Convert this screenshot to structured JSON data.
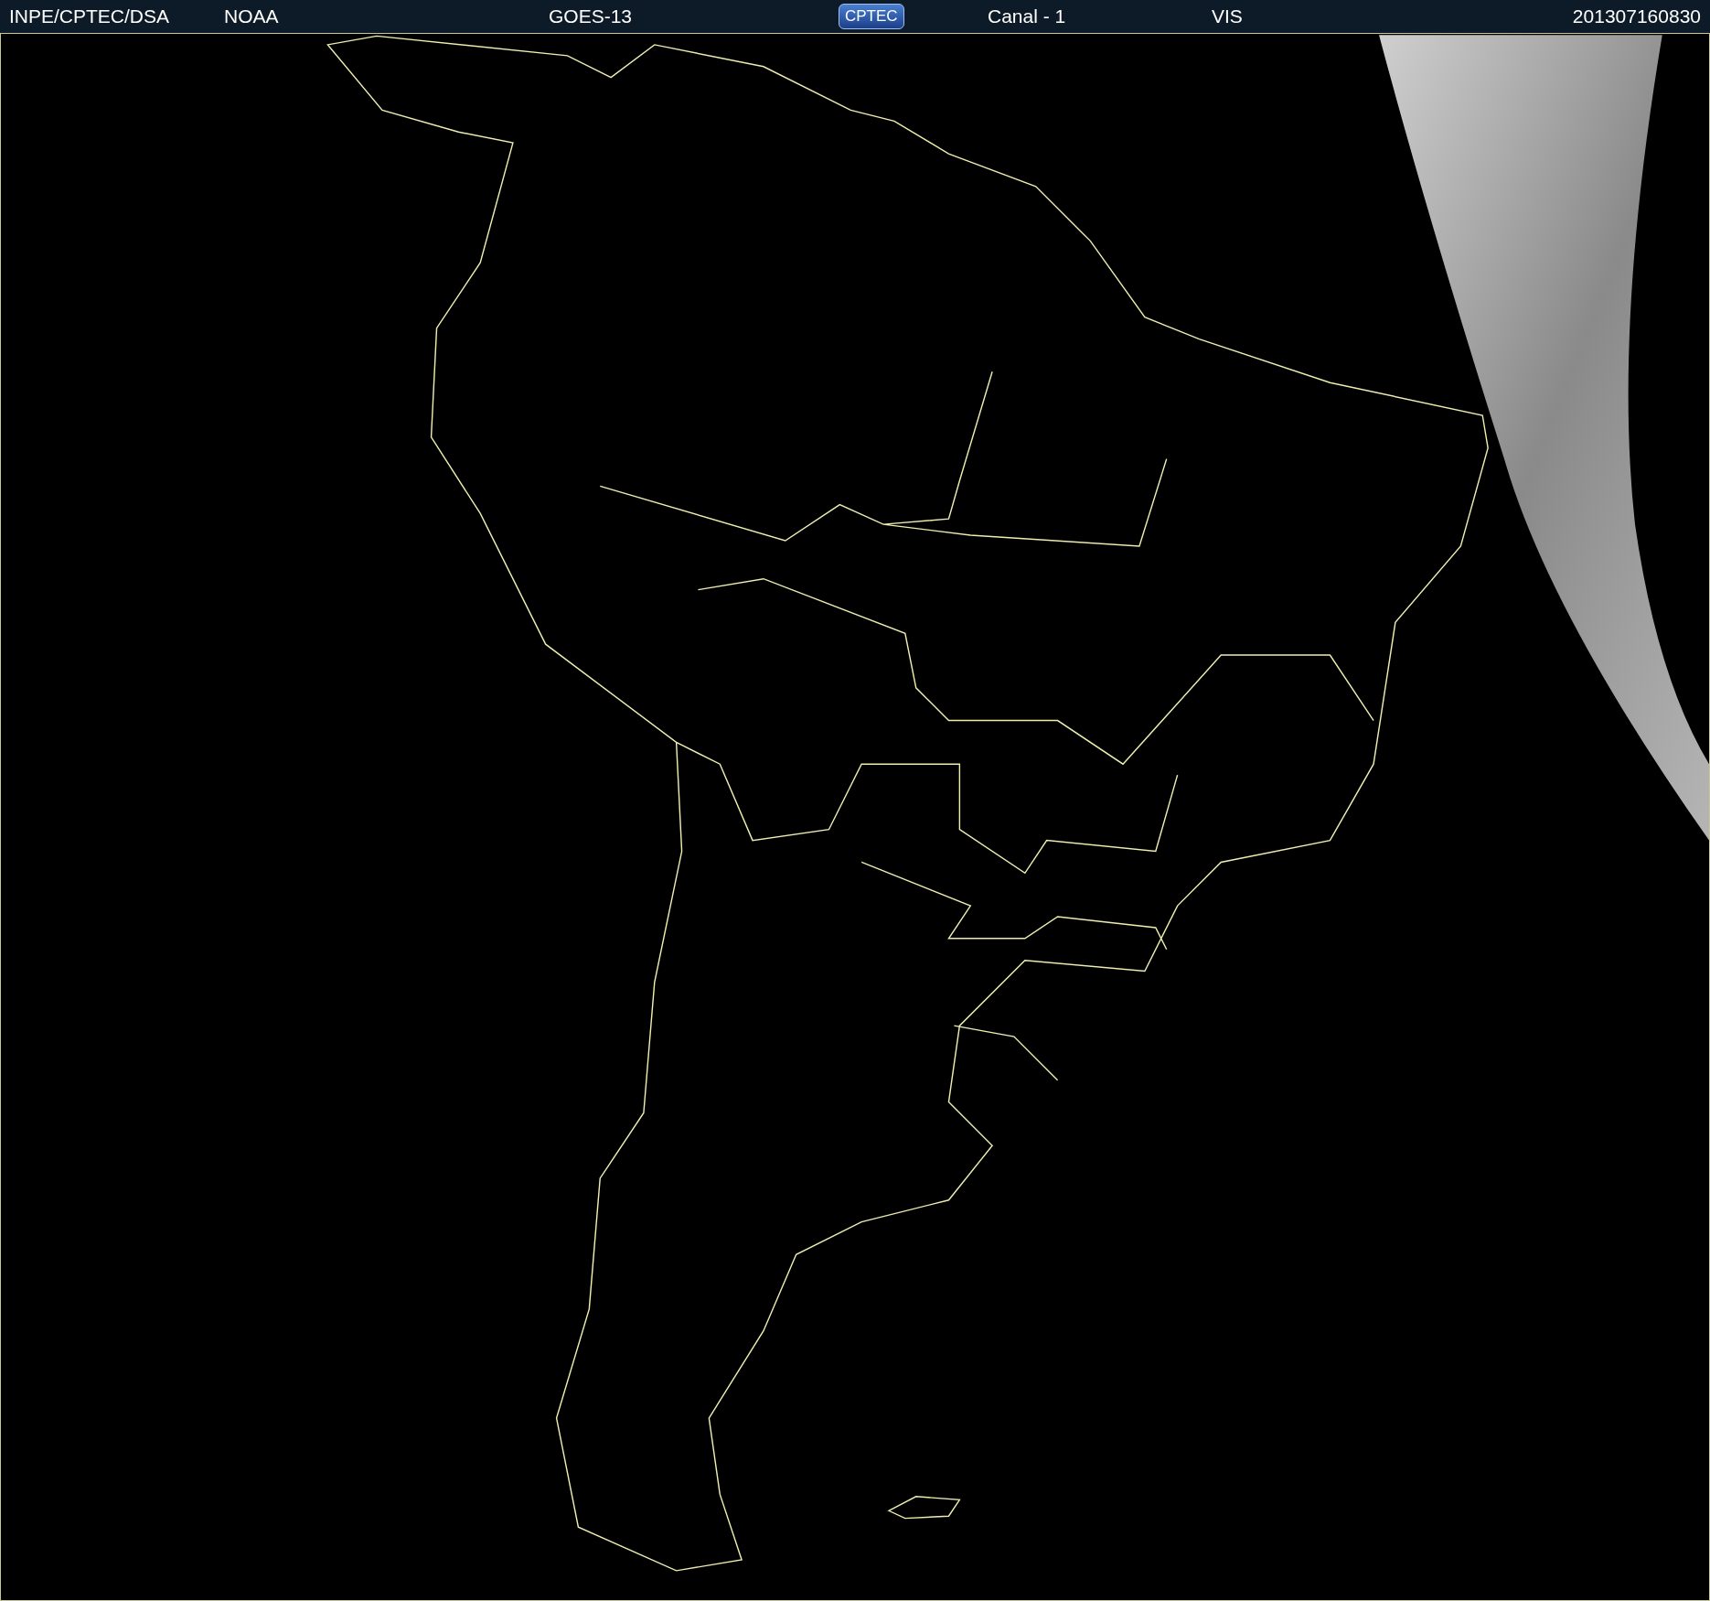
{
  "header": {
    "items": [
      {
        "kind": "text",
        "text": "INPE/CPTEC/DSA"
      },
      {
        "kind": "text",
        "text": "NOAA"
      },
      {
        "kind": "text",
        "text": "GOES-13"
      },
      {
        "kind": "logo",
        "text": "CPTEC"
      },
      {
        "kind": "text",
        "text": "Canal - 1"
      },
      {
        "kind": "text",
        "text": "VIS"
      },
      {
        "kind": "text",
        "text": "201307160830"
      }
    ]
  }
}
